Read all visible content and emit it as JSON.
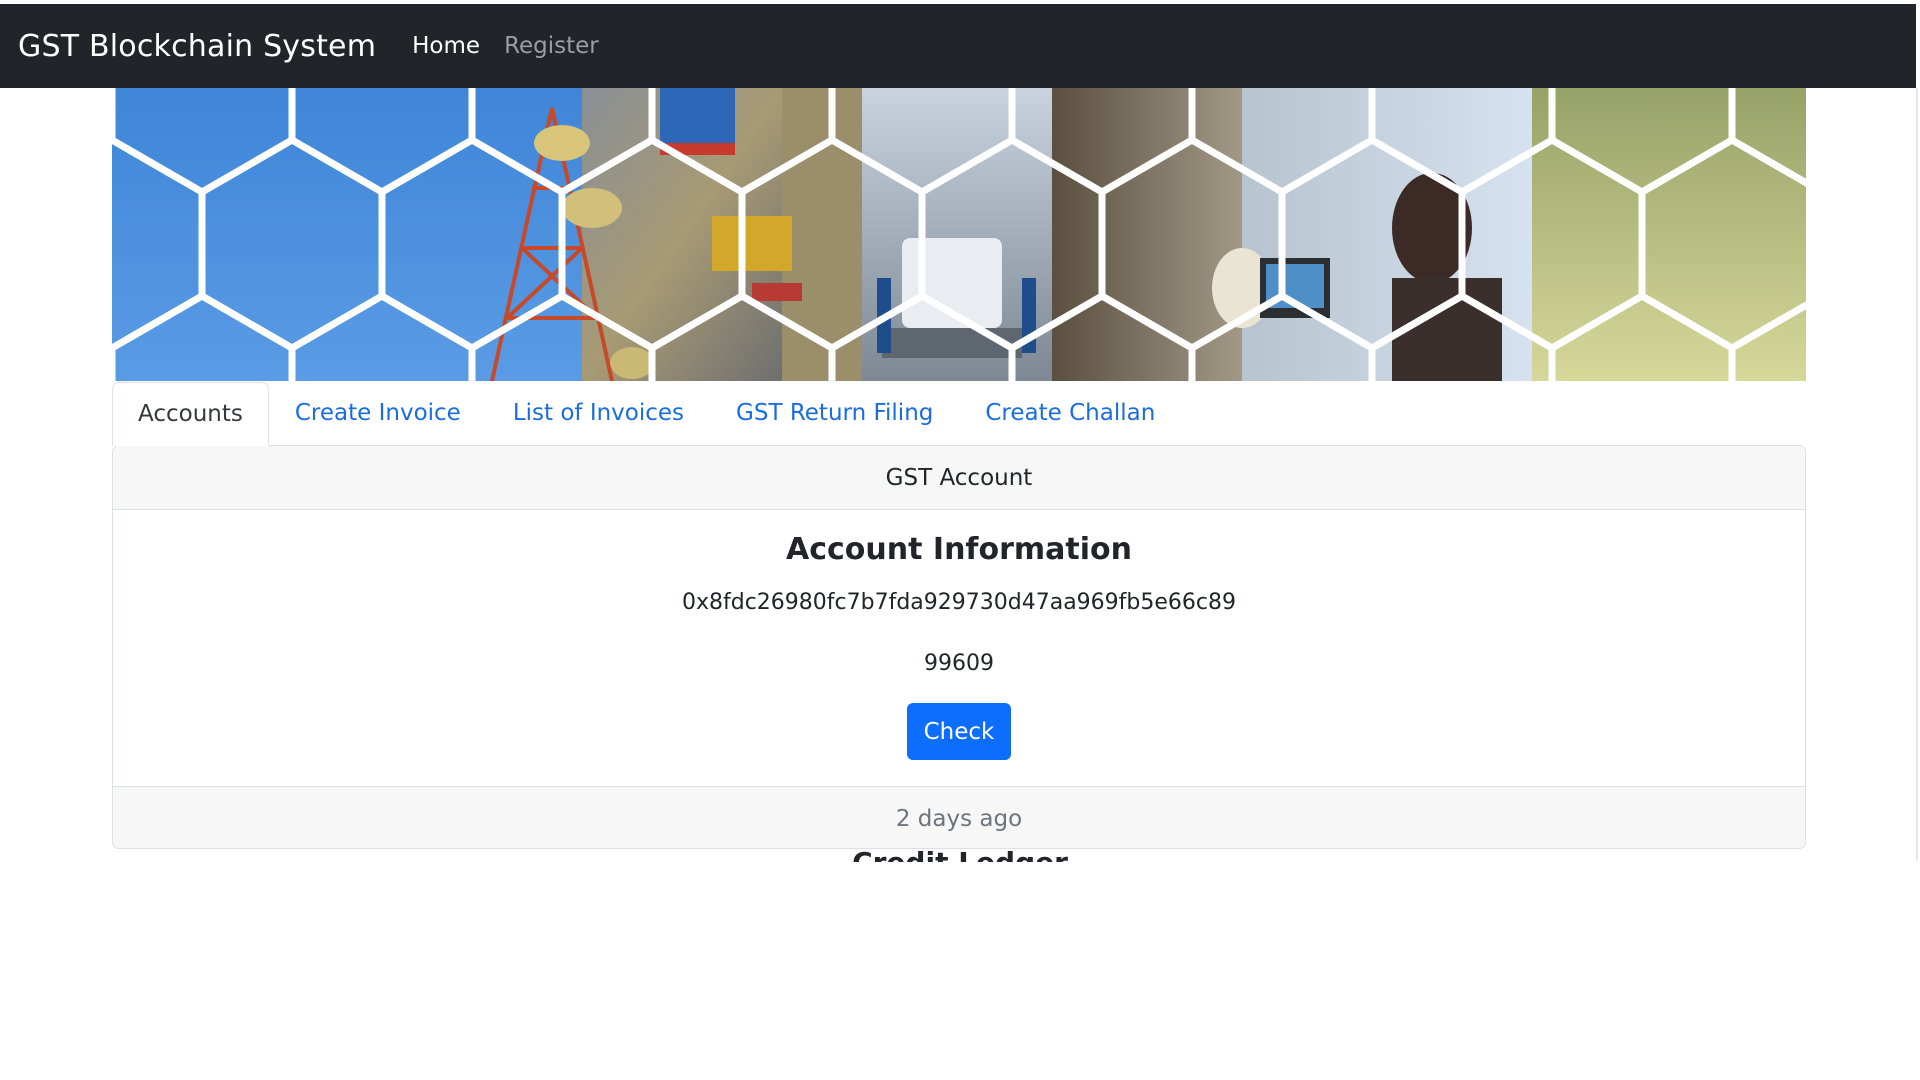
{
  "navbar": {
    "brand": "GST Blockchain System",
    "links": [
      {
        "label": "Home",
        "active": true
      },
      {
        "label": "Register",
        "active": false
      }
    ]
  },
  "tabs": [
    {
      "label": "Accounts",
      "active": true
    },
    {
      "label": "Create Invoice",
      "active": false
    },
    {
      "label": "List of Invoices",
      "active": false
    },
    {
      "label": "GST Return Filing",
      "active": false
    },
    {
      "label": "Create Challan",
      "active": false
    }
  ],
  "card": {
    "header": "GST Account",
    "title": "Account Information",
    "address": "0x8fdc26980fc7b7fda929730d47aa969fb5e66c89",
    "balance": "99609",
    "check_label": "Check",
    "footer": "2 days ago"
  },
  "next_section_title": "Credit Ledger",
  "colors": {
    "navbar_bg": "#212529",
    "primary_button": "#0d6efd",
    "tab_link": "#1a6de0",
    "muted": "#6c757d"
  },
  "icons": {
    "banner": "industry-hexagon-collage"
  }
}
